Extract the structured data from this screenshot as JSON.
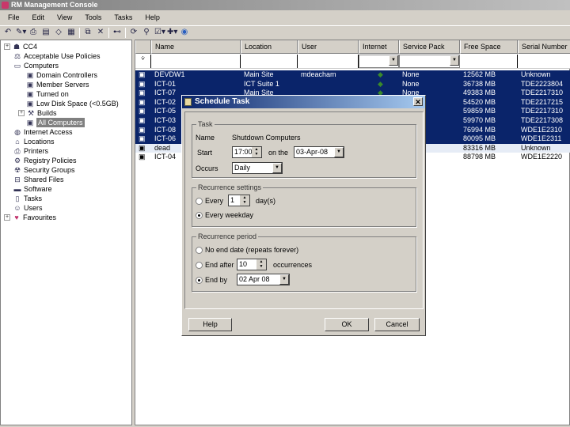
{
  "app": {
    "title": "RM Management Console"
  },
  "menu": [
    "File",
    "Edit",
    "View",
    "Tools",
    "Tasks",
    "Help"
  ],
  "tree": [
    {
      "label": "CC4",
      "icon": "network-icon",
      "level": 0,
      "exp": true
    },
    {
      "label": "Acceptable Use Policies",
      "icon": "policy-icon",
      "level": 1
    },
    {
      "label": "Computers",
      "icon": "computer-icon",
      "level": 1
    },
    {
      "label": "Domain Controllers",
      "icon": "group-icon",
      "level": 2
    },
    {
      "label": "Member Servers",
      "icon": "group-icon",
      "level": 2
    },
    {
      "label": "Turned on",
      "icon": "group-icon",
      "level": 2
    },
    {
      "label": "Low Disk Space (<0.5GB)",
      "icon": "group-icon",
      "level": 2
    },
    {
      "label": "Builds",
      "icon": "builds-icon",
      "level": 2,
      "exp": true
    },
    {
      "label": "All Computers",
      "icon": "group-icon",
      "level": 2,
      "selected": true
    },
    {
      "label": "Internet Access",
      "icon": "internet-icon",
      "level": 1
    },
    {
      "label": "Locations",
      "icon": "house-icon",
      "level": 1
    },
    {
      "label": "Printers",
      "icon": "printer-icon",
      "level": 1
    },
    {
      "label": "Registry Policies",
      "icon": "registry-icon",
      "level": 1
    },
    {
      "label": "Security Groups",
      "icon": "security-icon",
      "level": 1
    },
    {
      "label": "Shared Files",
      "icon": "shared-icon",
      "level": 1
    },
    {
      "label": "Software",
      "icon": "software-icon",
      "level": 1
    },
    {
      "label": "Tasks",
      "icon": "tasks-icon",
      "level": 1
    },
    {
      "label": "Users",
      "icon": "users-icon",
      "level": 1
    },
    {
      "label": "Favourites",
      "icon": "heart-icon",
      "level": 0,
      "exp": true
    }
  ],
  "columns": [
    "Name",
    "Location",
    "User",
    "Internet",
    "Service Pack",
    "Free Space",
    "Serial Number"
  ],
  "rows": [
    {
      "name": "DEVDW1",
      "location": "Main Site",
      "user": "mdeacham",
      "internet": true,
      "sp": "None",
      "free": "12562 MB",
      "serial": "Unknown",
      "state": "s"
    },
    {
      "name": "ICT-01",
      "location": "ICT Suite 1",
      "user": "",
      "internet": true,
      "sp": "None",
      "free": "36738 MB",
      "serial": "TDE2223804",
      "state": "s"
    },
    {
      "name": "ICT-07",
      "location": "Main Site",
      "user": "",
      "internet": true,
      "sp": "None",
      "free": "49383 MB",
      "serial": "TDE2217310",
      "state": "s"
    },
    {
      "name": "ICT-02",
      "location": "",
      "user": "",
      "internet": false,
      "sp": "",
      "free": "54520 MB",
      "serial": "TDE2217215",
      "state": "s"
    },
    {
      "name": "ICT-05",
      "location": "",
      "user": "",
      "internet": false,
      "sp": "",
      "free": "59859 MB",
      "serial": "TDE2217310",
      "state": "s"
    },
    {
      "name": "ICT-03",
      "location": "",
      "user": "",
      "internet": false,
      "sp": "",
      "free": "59970 MB",
      "serial": "TDE2217308",
      "state": "s"
    },
    {
      "name": "ICT-08",
      "location": "",
      "user": "",
      "internet": false,
      "sp": "",
      "free": "76994 MB",
      "serial": "WDE1E2310",
      "state": "s"
    },
    {
      "name": "ICT-06",
      "location": "",
      "user": "",
      "internet": false,
      "sp": "",
      "free": "80095 MB",
      "serial": "WDE1E2311",
      "state": "s"
    },
    {
      "name": "dead",
      "location": "",
      "user": "",
      "internet": false,
      "sp": "",
      "free": "83316 MB",
      "serial": "Unknown",
      "state": "l"
    },
    {
      "name": "ICT-04",
      "location": "",
      "user": "",
      "internet": false,
      "sp": "",
      "free": "88798 MB",
      "serial": "WDE1E2220",
      "state": ""
    }
  ],
  "dialog": {
    "title": "Schedule Task",
    "task_group": "Task",
    "name_label": "Name",
    "name_value": "Shutdown Computers",
    "start_label": "Start",
    "time": "17:00",
    "on_label": "on the",
    "date": "03-Apr-08",
    "occurs_label": "Occurs",
    "occurs": "Daily",
    "rec_group": "Recurrence settings",
    "every_label": "Every",
    "every_value": "1",
    "days_label": "day(s)",
    "weekday_label": "Every weekday",
    "period_group": "Recurrence period",
    "noend_label": "No end date (repeats forever)",
    "endafter_label": "End after",
    "endafter_value": "10",
    "occurrences_label": "occurrences",
    "endby_label": "End by",
    "endby_value": "02 Apr 08",
    "help": "Help",
    "ok": "OK",
    "cancel": "Cancel"
  }
}
